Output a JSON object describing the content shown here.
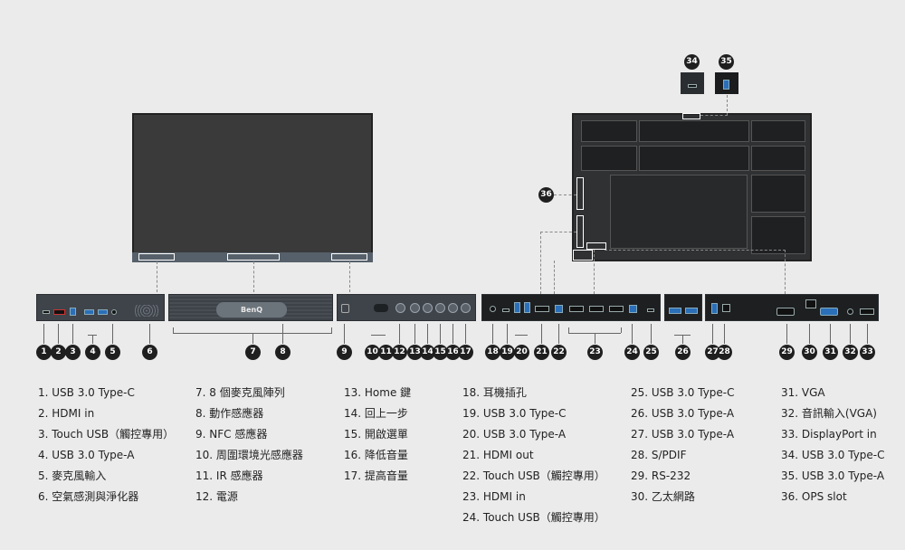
{
  "front": {
    "brand": "BenQ"
  },
  "markers": {
    "n1": "1",
    "n2": "2",
    "n3": "3",
    "n4": "4",
    "n5": "5",
    "n6": "6",
    "n7": "7",
    "n8": "8",
    "n9": "9",
    "n10": "10",
    "n11": "11",
    "n12": "12",
    "n13": "13",
    "n14": "14",
    "n15": "15",
    "n16": "16",
    "n17": "17",
    "n18": "18",
    "n19": "19",
    "n20": "20",
    "n21": "21",
    "n22": "22",
    "n23": "23",
    "n24": "24",
    "n25": "25",
    "n26": "26",
    "n27": "27",
    "n28": "28",
    "n29": "29",
    "n30": "30",
    "n31": "31",
    "n32": "32",
    "n33": "33",
    "n34": "34",
    "n35": "35",
    "n36": "36"
  },
  "legend": {
    "col1": [
      "1. USB 3.0 Type-C",
      "2. HDMI in",
      "3. Touch USB（觸控專用）",
      "4. USB 3.0 Type-A",
      "5. 麥克風輸入",
      "6. 空氣感測與淨化器"
    ],
    "col2": [
      "7. 8 個麥克風陣列",
      "8. 動作感應器",
      "9. NFC 感應器",
      "10. 周圍環境光感應器",
      "11. IR 感應器",
      "12. 電源"
    ],
    "col3": [
      "13. Home 鍵",
      "14. 回上一步",
      "15. 開啟選單",
      "16. 降低音量",
      "17. 提高音量"
    ],
    "col4": [
      "18. 耳機插孔",
      "19. USB 3.0 Type-C",
      "20. USB 3.0 Type-A",
      "21. HDMI out",
      "22. Touch USB（觸控專用）",
      "23. HDMI in",
      "24. Touch USB（觸控專用）"
    ],
    "col5": [
      "25. USB 3.0 Type-C",
      "26. USB 3.0 Type-A",
      "27. USB 3.0 Type-A",
      "28. S/PDIF",
      "29. RS-232",
      "30. 乙太網路"
    ],
    "col6": [
      "31. VGA",
      "32. 音訊輸入(VGA)",
      "33. DisplayPort in",
      "34. USB 3.0 Type-C",
      "35. USB 3.0 Type-A",
      "36. OPS slot"
    ]
  }
}
